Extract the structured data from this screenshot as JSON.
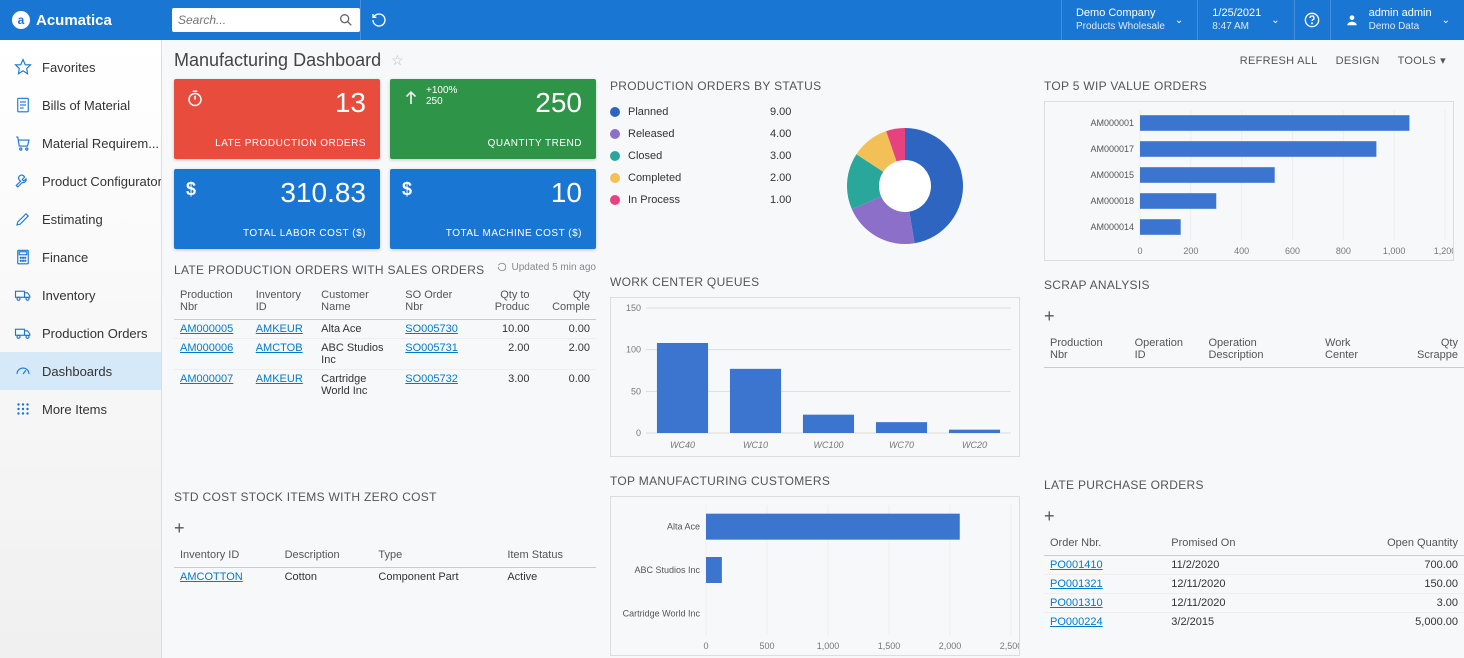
{
  "header": {
    "brand": "Acumatica",
    "search_placeholder": "Search...",
    "company": {
      "line1": "Demo Company",
      "line2": "Products Wholesale"
    },
    "date": {
      "line1": "1/25/2021",
      "line2": "8:47 AM"
    },
    "user": {
      "line1": "admin admin",
      "line2": "Demo Data"
    }
  },
  "sidebar": {
    "items": [
      {
        "label": "Favorites",
        "icon": "star"
      },
      {
        "label": "Bills of Material",
        "icon": "bom"
      },
      {
        "label": "Material Requirem...",
        "icon": "cart"
      },
      {
        "label": "Product Configurator",
        "icon": "wrench"
      },
      {
        "label": "Estimating",
        "icon": "pencil"
      },
      {
        "label": "Finance",
        "icon": "calc"
      },
      {
        "label": "Inventory",
        "icon": "truck"
      },
      {
        "label": "Production Orders",
        "icon": "truck2"
      },
      {
        "label": "Dashboards",
        "icon": "gauge",
        "active": true
      },
      {
        "label": "More Items",
        "icon": "grid"
      }
    ]
  },
  "page": {
    "title": "Manufacturing Dashboard",
    "actions": {
      "refresh": "REFRESH ALL",
      "design": "DESIGN",
      "tools": "TOOLS"
    }
  },
  "kpis": {
    "late_po": {
      "value": "13",
      "label": "LATE PRODUCTION ORDERS"
    },
    "qty_trend": {
      "value": "250",
      "label": "QUANTITY TREND",
      "trend_pct": "+100%",
      "trend_prev": "250"
    },
    "labor": {
      "value": "310.83",
      "label": "TOTAL LABOR COST ($)"
    },
    "machine": {
      "value": "10",
      "label": "TOTAL MACHINE COST ($)"
    }
  },
  "late_table": {
    "title": "LATE PRODUCTION ORDERS WITH SALES ORDERS",
    "updated": "Updated 5 min ago",
    "cols": [
      "Production Nbr",
      "Inventory ID",
      "Customer Name",
      "SO Order Nbr",
      "Qty to Produc",
      "Qty Comple"
    ],
    "rows": [
      {
        "pn": "AM000005",
        "inv": "AMKEUR",
        "cust": "Alta Ace",
        "so": "SO005730",
        "qtyp": "10.00",
        "qtyc": "0.00"
      },
      {
        "pn": "AM000006",
        "inv": "AMCTOB",
        "cust": "ABC Studios Inc",
        "so": "SO005731",
        "qtyp": "2.00",
        "qtyc": "2.00"
      },
      {
        "pn": "AM000007",
        "inv": "AMKEUR",
        "cust": "Cartridge World Inc",
        "so": "SO005732",
        "qtyp": "3.00",
        "qtyc": "0.00"
      }
    ]
  },
  "zero_cost": {
    "title": "STD COST STOCK ITEMS WITH ZERO COST",
    "cols": [
      "Inventory ID",
      "Description",
      "Type",
      "Item Status"
    ],
    "rows": [
      {
        "inv": "AMCOTTON",
        "desc": "Cotton",
        "type": "Component Part",
        "status": "Active"
      }
    ]
  },
  "status_pie": {
    "title": "PRODUCTION ORDERS BY STATUS"
  },
  "queues": {
    "title": "WORK CENTER QUEUES"
  },
  "top_customers": {
    "title": "TOP MANUFACTURING CUSTOMERS"
  },
  "wip": {
    "title": "TOP 5 WIP VALUE ORDERS"
  },
  "scrap": {
    "title": "SCRAP ANALYSIS",
    "cols": [
      "Production Nbr",
      "Operation ID",
      "Operation Description",
      "Work Center",
      "Qty Scrappe"
    ]
  },
  "late_purchase": {
    "title": "LATE PURCHASE ORDERS",
    "cols": [
      "Order Nbr.",
      "Promised On",
      "Open Quantity"
    ],
    "rows": [
      {
        "nbr": "PO001410",
        "date": "11/2/2020",
        "qty": "700.00"
      },
      {
        "nbr": "PO001321",
        "date": "12/11/2020",
        "qty": "150.00"
      },
      {
        "nbr": "PO001310",
        "date": "12/11/2020",
        "qty": "3.00"
      },
      {
        "nbr": "PO000224",
        "date": "3/2/2015",
        "qty": "5,000.00"
      }
    ]
  },
  "chart_data": [
    {
      "id": "production_orders_by_status",
      "type": "pie",
      "title": "PRODUCTION ORDERS BY STATUS",
      "series": [
        {
          "name": "Planned",
          "value": 9.0,
          "color": "#2d65c0"
        },
        {
          "name": "Released",
          "value": 4.0,
          "color": "#8b6fc9"
        },
        {
          "name": "Closed",
          "value": 3.0,
          "color": "#2aa79b"
        },
        {
          "name": "Completed",
          "value": 2.0,
          "color": "#f2c057"
        },
        {
          "name": "In Process",
          "value": 1.0,
          "color": "#e6427f"
        }
      ]
    },
    {
      "id": "work_center_queues",
      "type": "bar",
      "title": "WORK CENTER QUEUES",
      "categories": [
        "WC40",
        "WC10",
        "WC100",
        "WC70",
        "WC20"
      ],
      "values": [
        108,
        77,
        22,
        13,
        4
      ],
      "ylim": [
        0,
        150
      ],
      "yticks": [
        0,
        50,
        100,
        150
      ],
      "color": "#3b75d0"
    },
    {
      "id": "top_manufacturing_customers",
      "type": "bar-horizontal",
      "title": "TOP MANUFACTURING CUSTOMERS",
      "categories": [
        "Alta Ace",
        "ABC Studios Inc",
        "Cartridge World Inc"
      ],
      "values": [
        2080,
        130,
        0
      ],
      "xlim": [
        0,
        2500
      ],
      "xticks": [
        0,
        500,
        1000,
        1500,
        2000,
        2500
      ],
      "color": "#3b75d0"
    },
    {
      "id": "top5_wip_value_orders",
      "type": "bar-horizontal",
      "title": "TOP 5 WIP VALUE ORDERS",
      "categories": [
        "AM000001",
        "AM000017",
        "AM000015",
        "AM000018",
        "AM000014"
      ],
      "values": [
        1060,
        930,
        530,
        300,
        160
      ],
      "xlim": [
        0,
        1200
      ],
      "xticks": [
        0,
        200,
        400,
        600,
        800,
        1000,
        1200
      ],
      "color": "#3b75d0"
    }
  ]
}
